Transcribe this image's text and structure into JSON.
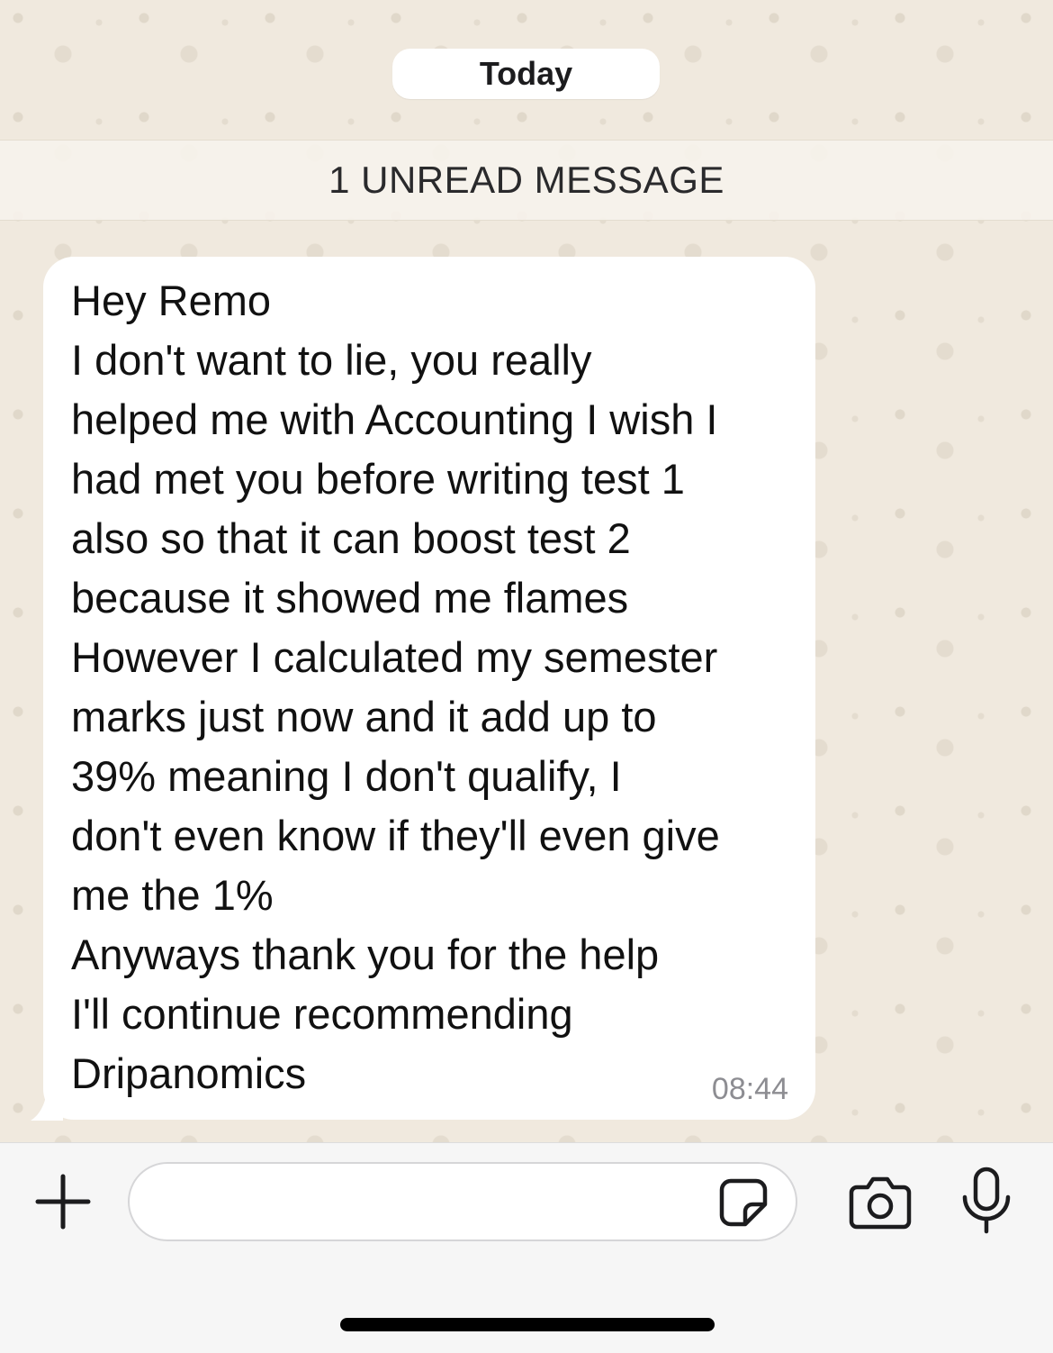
{
  "chat": {
    "date_label": "Today",
    "unread_label": "1 UNREAD MESSAGE",
    "message": {
      "text": "Hey Remo\nI don't want to lie, you really\nhelped me with Accounting I wish I\nhad met you before writing test 1\nalso so that it can boost test 2\nbecause it showed me flames\nHowever I calculated my semester\nmarks just now and it add up to\n39% meaning I don't qualify, I\ndon't even know if they'll even give\nme the 1%\nAnyways thank you for the help\nI'll continue recommending\nDripanomics",
      "time": "08:44"
    }
  },
  "composer": {
    "value": "",
    "icons": {
      "attach": "plus-icon",
      "sticker": "sticker-icon",
      "camera": "camera-icon",
      "mic": "microphone-icon"
    }
  },
  "colors": {
    "wallpaper": "#f0e9de",
    "bubble": "#ffffff",
    "text": "#111111",
    "timestamp": "#8d8d92",
    "composer_bg": "#f6f6f6"
  }
}
